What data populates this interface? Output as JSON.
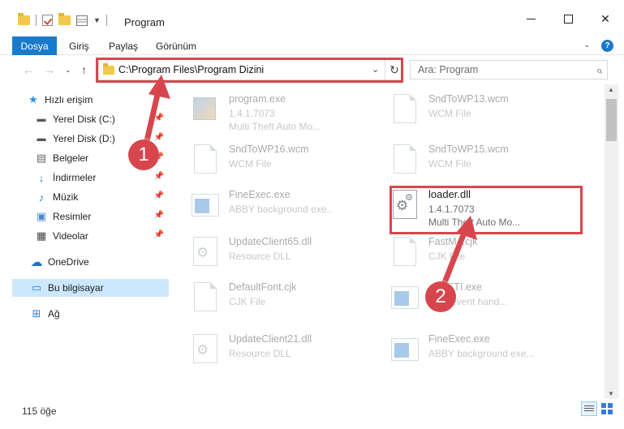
{
  "window": {
    "title": "Program",
    "minimize": "",
    "maximize": "",
    "close": "✕"
  },
  "ribbon": {
    "tabs": [
      "Dosya",
      "Giriş",
      "Paylaş",
      "Görünüm"
    ],
    "help": "?"
  },
  "address": {
    "path": "C:\\Program Files\\Program Dizini",
    "refresh": "↻",
    "chevron": "⌄"
  },
  "search": {
    "placeholder": "Ara: Program"
  },
  "sidebar": {
    "items": [
      {
        "label": "Hızlı erişim",
        "icon": "star-icon"
      },
      {
        "label": "Yerel Disk (C:)",
        "icon": "drive-icon",
        "pinned": true
      },
      {
        "label": "Yerel Disk (D:)",
        "icon": "drive-icon",
        "pinned": true
      },
      {
        "label": "Belgeler",
        "icon": "documents-icon",
        "pinned": true
      },
      {
        "label": "İndirmeler",
        "icon": "download-icon",
        "pinned": true
      },
      {
        "label": "Müzik",
        "icon": "music-icon",
        "pinned": true
      },
      {
        "label": "Resimler",
        "icon": "pictures-icon",
        "pinned": true
      },
      {
        "label": "Videolar",
        "icon": "video-icon",
        "pinned": true
      },
      {
        "label": "OneDrive",
        "icon": "cloud-icon"
      },
      {
        "label": "Bu bilgisayar",
        "icon": "computer-icon",
        "selected": true
      },
      {
        "label": "Ağ",
        "icon": "network-icon"
      }
    ]
  },
  "files": [
    {
      "name": "program.exe",
      "line2": "1.4.1.7073",
      "line3": "Multi Theft Auto Mo...",
      "kind": "exe"
    },
    {
      "name": "SndToWP13.wcm",
      "line2": "WCM File",
      "line3": "",
      "kind": "doc"
    },
    {
      "name": "SndToWP16.wcm",
      "line2": "WCM File",
      "line3": "",
      "kind": "doc"
    },
    {
      "name": "SndToWP15.wcm",
      "line2": "WCM File",
      "line3": "",
      "kind": "doc"
    },
    {
      "name": "FineExec.exe",
      "line2": "ABBY background exe...",
      "line3": "",
      "kind": "app"
    },
    {
      "name": "loader.dll",
      "line2": "1.4.1.7073",
      "line3": "Multi Theft Auto Mo...",
      "kind": "dll",
      "focus": true
    },
    {
      "name": "UpdateClient65.dll",
      "line2": "Resource DLL",
      "line3": "",
      "kind": "dll"
    },
    {
      "name": "FastM...cjk",
      "line2": "CJK File",
      "line3": "",
      "kind": "doc"
    },
    {
      "name": "DefaultFont.cjk",
      "line2": "CJK File",
      "line3": "",
      "kind": "doc"
    },
    {
      "name": "...sySTI.exe",
      "line2": "...ick event hand...",
      "line3": "",
      "kind": "app"
    },
    {
      "name": "UpdateClient21.dll",
      "line2": "Resource DLL",
      "line3": "",
      "kind": "dll"
    },
    {
      "name": "FineExec.exe",
      "line2": "ABBY background exe...",
      "line3": "",
      "kind": "app"
    }
  ],
  "status": {
    "count": "115 öğe"
  },
  "annotations": {
    "step1": "1",
    "step2": "2"
  },
  "colors": {
    "accent": "#1979ca",
    "highlight": "#d8464d",
    "selected": "#cce8ff"
  }
}
